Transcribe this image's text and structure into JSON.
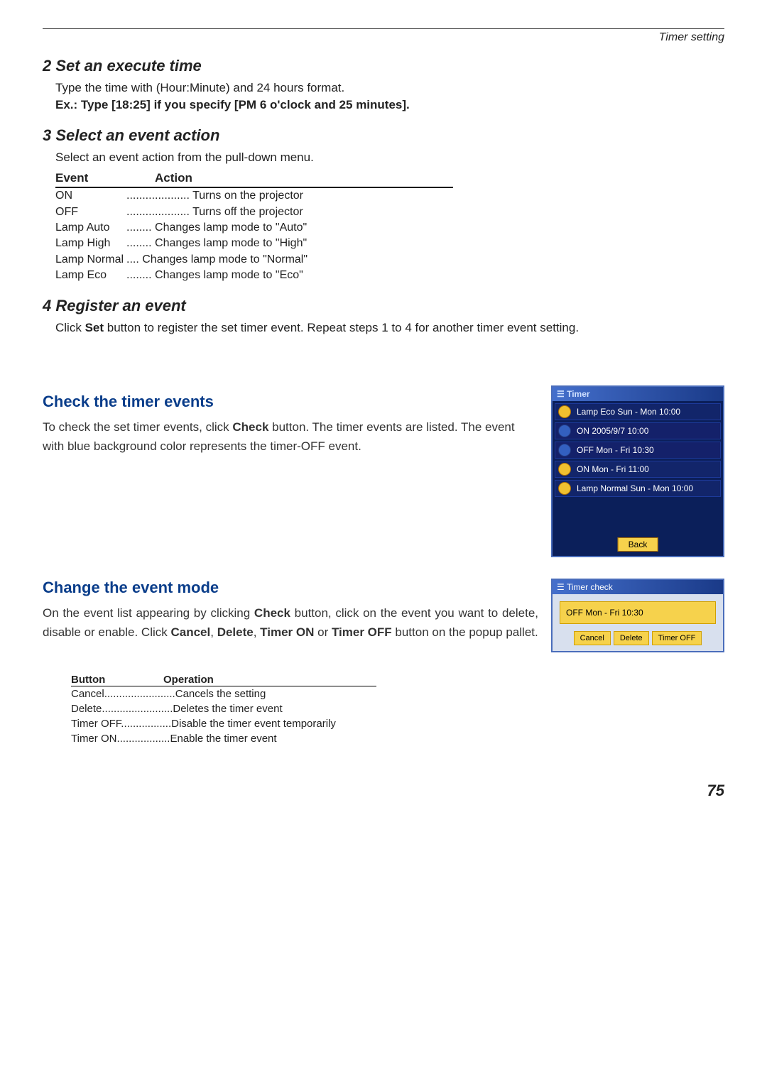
{
  "header": {
    "section": "Timer setting"
  },
  "step2": {
    "title": "2 Set an execute time",
    "line1": "Type the time with (Hour:Minute) and 24 hours format.",
    "line2": "Ex.: Type [18:25] if you specify [PM 6 o'clock and 25 minutes]."
  },
  "step3": {
    "title": "3 Select an event action",
    "intro": "Select an event action from the pull-down menu.",
    "head_event": "Event",
    "head_action": "Action",
    "rows": [
      {
        "event": "ON",
        "action": "Turns on the projector"
      },
      {
        "event": "OFF",
        "action": "Turns off the projector"
      },
      {
        "event": "Lamp Auto",
        "action": "Changes lamp mode to \"Auto\""
      },
      {
        "event": "Lamp High",
        "action": "Changes lamp mode to \"High\""
      },
      {
        "event": "Lamp Normal",
        "action": "Changes lamp mode to \"Normal\""
      },
      {
        "event": "Lamp Eco",
        "action": "Changes lamp mode to \"Eco\""
      }
    ]
  },
  "step4": {
    "title": "4 Register an event",
    "text_pre": "Click ",
    "text_bold": "Set",
    "text_post": " button to register the set timer event. Repeat steps 1 to 4 for another timer event setting."
  },
  "check": {
    "title": "Check the timer events",
    "p_pre": "To check the set timer events, click ",
    "p_bold": "Check",
    "p_post": " button. The timer events are listed. The event with blue background color represents the timer-OFF event."
  },
  "shot1": {
    "title": "Timer",
    "rows": [
      {
        "icon": "yellow",
        "text": "Lamp Eco Sun - Mon 10:00"
      },
      {
        "icon": "blue",
        "text": "ON 2005/9/7 10:00"
      },
      {
        "icon": "blue",
        "text": "OFF Mon - Fri 10:30"
      },
      {
        "icon": "yellow",
        "text": "ON Mon - Fri 11:00"
      },
      {
        "icon": "yellow",
        "text": "Lamp Normal Sun - Mon 10:00"
      }
    ],
    "back": "Back"
  },
  "change": {
    "title": "Change the event mode",
    "p1": "On the event list appearing by clicking ",
    "b1": "Check",
    "p2": " button, click on the event you want to delete, disable or enable. Click ",
    "b2": "Cancel",
    "p3": ", ",
    "b3": "Delete",
    "p4": ", ",
    "b4": "Timer ON",
    "p5": " or ",
    "b5": "Timer OFF",
    "p6": " button on the popup pallet."
  },
  "shot2": {
    "title": "Timer check",
    "selected": "OFF Mon - Fri 10:30",
    "buttons": [
      "Cancel",
      "Delete",
      "Timer OFF"
    ]
  },
  "btntable": {
    "head_button": "Button",
    "head_op": "Operation",
    "rows": [
      {
        "button": "Cancel",
        "op": "Cancels the setting"
      },
      {
        "button": "Delete",
        "op": "Deletes the timer event"
      },
      {
        "button": "Timer OFF",
        "op": "Disable the timer event temporarily"
      },
      {
        "button": "Timer ON",
        "op": "Enable the timer event"
      }
    ]
  },
  "page": {
    "num": "75"
  }
}
